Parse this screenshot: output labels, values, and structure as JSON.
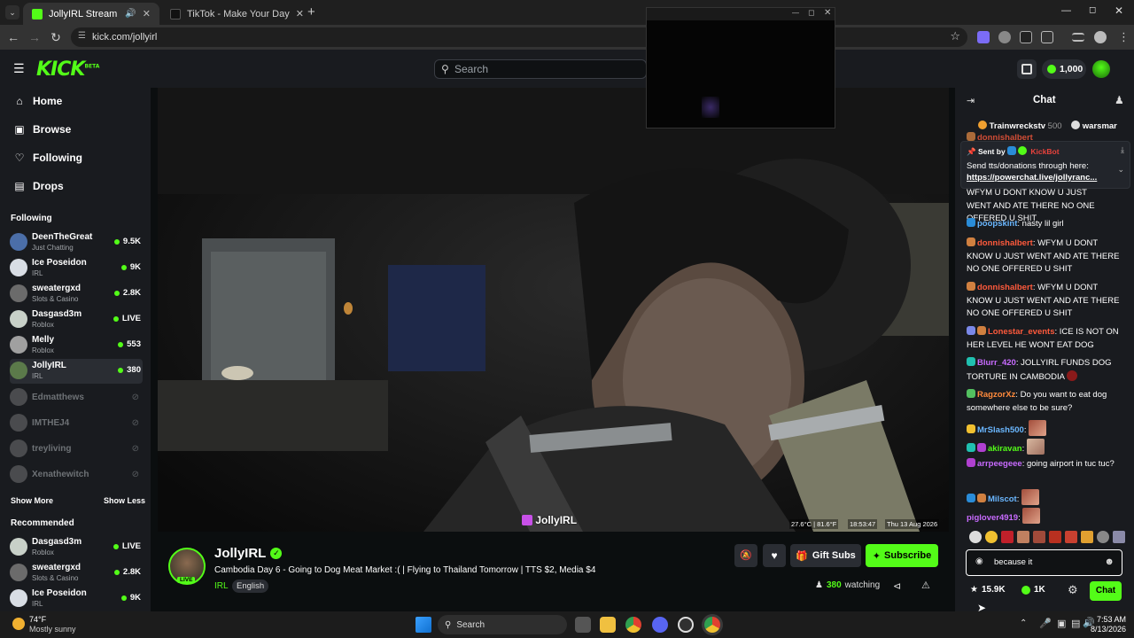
{
  "browser": {
    "tabs": [
      {
        "title": "JollyIRL Stream - Watch Live"
      },
      {
        "title": "TikTok - Make Your Day"
      }
    ],
    "url": "kick.com/jollyirl"
  },
  "header": {
    "logo": "KICK",
    "beta": "BETA",
    "search_placeholder": "Search",
    "kicks_balance": "1,000"
  },
  "sidebar": {
    "nav": [
      {
        "label": "Home",
        "icon": "home-icon"
      },
      {
        "label": "Browse",
        "icon": "browse-icon"
      },
      {
        "label": "Following",
        "icon": "heart-icon"
      },
      {
        "label": "Drops",
        "icon": "drops-icon"
      }
    ],
    "following_title": "Following",
    "following": [
      {
        "name": "DeenTheGreat",
        "category": "Just Chatting",
        "viewers": "9.5K"
      },
      {
        "name": "Ice Poseidon",
        "category": "IRL",
        "viewers": "9K"
      },
      {
        "name": "sweatergxd",
        "category": "Slots & Casino",
        "viewers": "2.8K"
      },
      {
        "name": "Dasgasd3m",
        "category": "Roblox",
        "viewers": "LIVE"
      },
      {
        "name": "Melly",
        "category": "Roblox",
        "viewers": "553"
      },
      {
        "name": "JollyIRL",
        "category": "IRL",
        "viewers": "380"
      }
    ],
    "offline": [
      "Edmatthews",
      "IMTHEJ4",
      "treyliving",
      "Xenathewitch"
    ],
    "show_more": "Show More",
    "show_less": "Show Less",
    "recommended_title": "Recommended",
    "recommended": [
      {
        "name": "Dasgasd3m",
        "category": "Roblox",
        "viewers": "LIVE"
      },
      {
        "name": "sweatergxd",
        "category": "Slots & Casino",
        "viewers": "2.8K"
      },
      {
        "name": "Ice Poseidon",
        "category": "IRL",
        "viewers": "9K"
      }
    ]
  },
  "video": {
    "overlay_name": "JollyIRL",
    "temp": "27.6°C | 81.6°F",
    "time": "18:53:47",
    "date": "Thu 13 Aug 2026"
  },
  "stream": {
    "channel": "JollyIRL",
    "live": "LIVE",
    "title": "Cambodia Day 6 - Going to Dog Meat Market :( | Flying to Thailand Tomorrow | TTS $2, Media $4",
    "category": "IRL",
    "language": "English",
    "gift_label": "Gift Subs",
    "subscribe_label": "Subscribe",
    "viewers": "380",
    "watching_label": "watching"
  },
  "chat": {
    "title": "Chat",
    "top_gifters": [
      {
        "name": "Trainwreckstv",
        "amount": "500"
      },
      {
        "name": "warsmar",
        "amount": ""
      }
    ],
    "pinned": {
      "sent_by_label": "Sent by",
      "sender": "KickBot",
      "text": "Send tts/donations through here:",
      "link": "https://powerchat.live/jollyranc..."
    },
    "messages": [
      {
        "user": "donnishalbert",
        "text": "WFYM U DONT KNOW U JUST WENT AND ATE THERE NO ONE OFFERED U SHIT",
        "color": "#ff5a3c"
      },
      {
        "user": "poopskint",
        "text": "nasty lil girl",
        "color": "#6ab7ff"
      },
      {
        "user": "donnishalbert",
        "text": "WFYM U DONT KNOW U JUST WENT AND ATE THERE NO ONE OFFERED U SHIT",
        "color": "#ff5a3c"
      },
      {
        "user": "donnishalbert",
        "text": "WFYM U DONT KNOW U JUST WENT AND ATE THERE NO ONE OFFERED U SHIT",
        "color": "#ff5a3c"
      },
      {
        "user": "Lonestar_events",
        "text": "ICE IS NOT ON HER LEVEL HE WONT EAT DOG",
        "color": "#ff5a3c"
      },
      {
        "user": "Blurr_420",
        "text": "JOLLYIRL FUNDS DOG TORTURE IN CAMBODIA",
        "color": "#c86bff"
      },
      {
        "user": "RagzorXz",
        "text": "Do you want to eat dog somewhere else to be sure?",
        "color": "#ff8a3c"
      },
      {
        "user": "MrSlash500",
        "text": "",
        "color": "#6ab7ff"
      },
      {
        "user": "akiravan",
        "text": "",
        "color": "#53fc18"
      },
      {
        "user": "arrpeegeee",
        "text": "going airport in tuc tuc?",
        "color": "#c86bff"
      },
      {
        "user": "Milscot",
        "text": "",
        "color": "#6ab7ff"
      },
      {
        "user": "piglover4919",
        "text": "",
        "color": "#c86bff"
      }
    ],
    "input_value": "because it",
    "points": "15.9K",
    "kicks": "1K",
    "send_label": "Chat"
  },
  "taskbar": {
    "weather_temp": "74°F",
    "weather_desc": "Mostly sunny",
    "search_label": "Search",
    "time": "7:53 AM",
    "date": "8/13/2026"
  }
}
